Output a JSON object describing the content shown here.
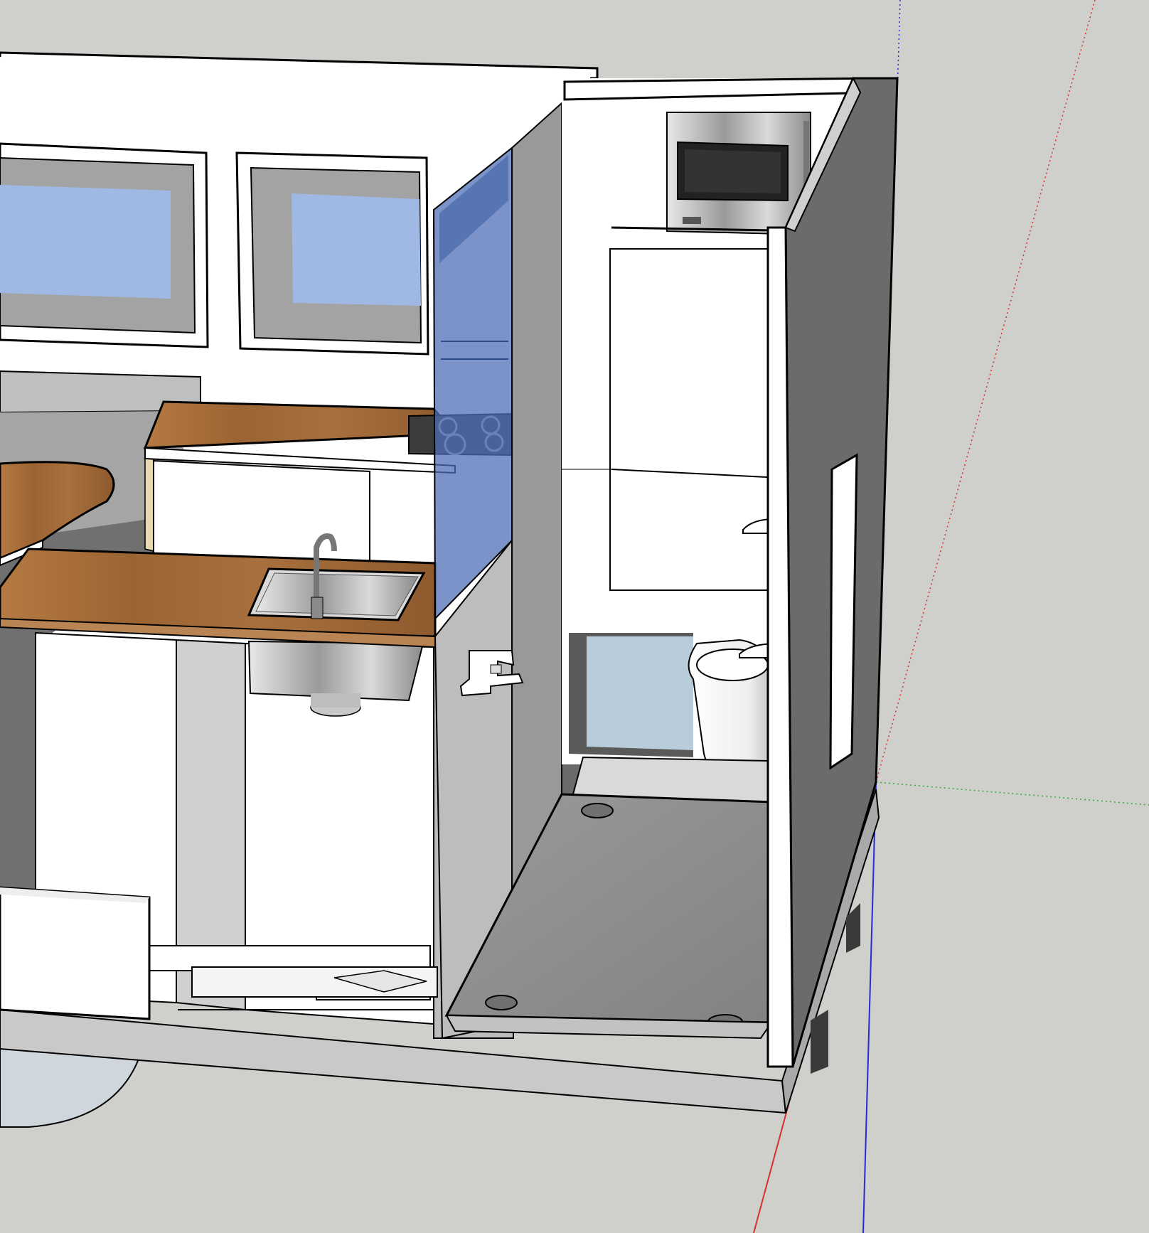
{
  "scene": {
    "background": "#cfcfcb",
    "axis_colors": {
      "x": "#d63030",
      "y": "#2fae3a",
      "z": "#2a2adb"
    },
    "colors": {
      "wall_white": "#ffffff",
      "panel_grey": "#bdbdbd",
      "panel_dark": "#6a6a6a",
      "window_blue": "#9fb9e4",
      "glass_blue": "#5577bb",
      "wood": "#a06a3a",
      "steel": "#c9c9c9",
      "shower_tray": "#8d8d8d",
      "floor_grey": "#cfcfcf"
    },
    "objects": [
      "walls",
      "window-left",
      "window-right",
      "bench-seat",
      "dining-table",
      "kitchen-counter-back",
      "cooktop",
      "kitchen-counter-front",
      "sink",
      "faucet",
      "glass-partition",
      "shower-panel",
      "mixer-valve",
      "microwave",
      "fridge",
      "toilet",
      "shower-tray",
      "side-wall",
      "door-opening",
      "pipes",
      "water-box",
      "chassis",
      "wheel"
    ]
  }
}
